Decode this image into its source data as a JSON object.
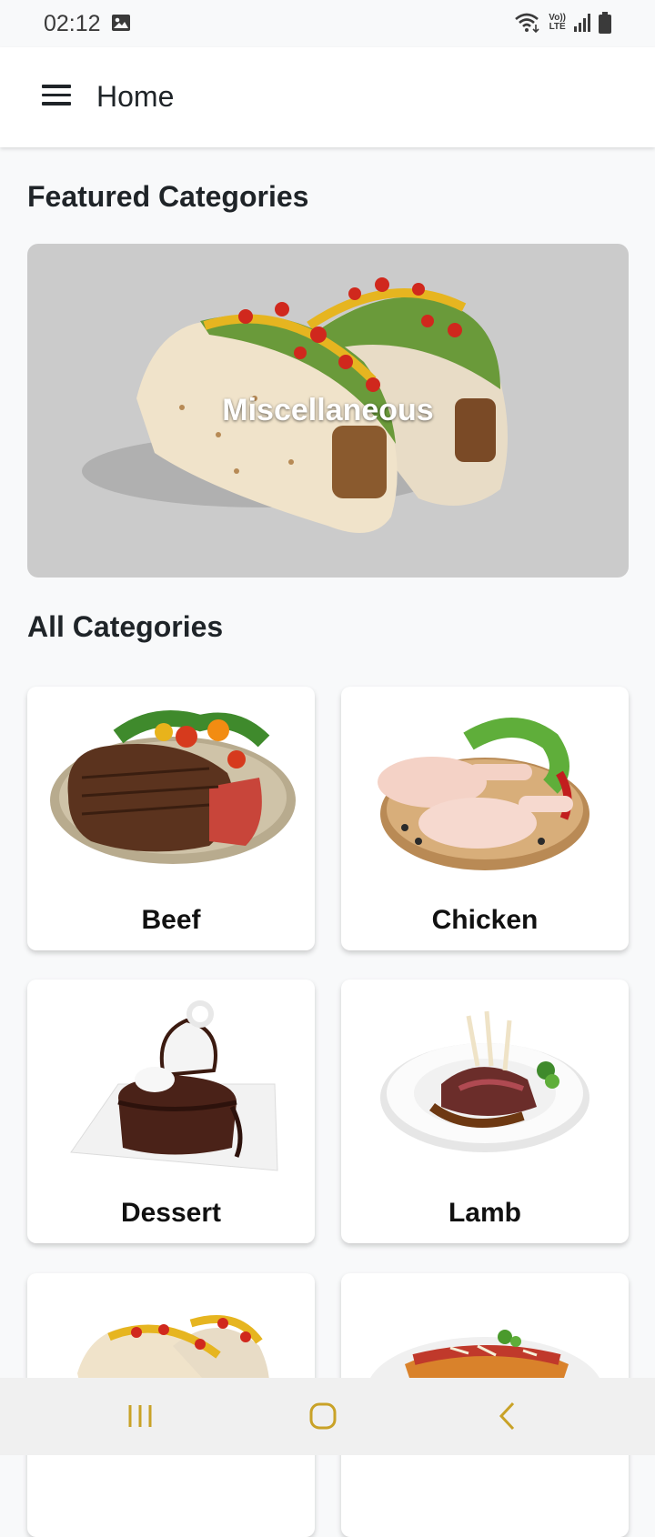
{
  "status_bar": {
    "time": "02:12",
    "icons": [
      "image-icon",
      "wifi-icon",
      "volte-icon",
      "signal-icon",
      "battery-icon"
    ],
    "network_label_top": "Vo))",
    "network_label_bottom": "LTE"
  },
  "app_bar": {
    "title": "Home",
    "menu_icon": "hamburger-menu-icon"
  },
  "featured": {
    "section_title": "Featured Categories",
    "card": {
      "label": "Miscellaneous",
      "image": "tacos-image"
    }
  },
  "all_categories": {
    "section_title": "All Categories",
    "items": [
      {
        "label": "Beef",
        "image": "steak-plate-image"
      },
      {
        "label": "Chicken",
        "image": "raw-chicken-legs-image"
      },
      {
        "label": "Dessert",
        "image": "chocolate-cake-image"
      },
      {
        "label": "Lamb",
        "image": "lamb-rack-image"
      },
      {
        "label": "",
        "image": "tacos-image"
      },
      {
        "label": "",
        "image": "pasta-image"
      }
    ]
  },
  "nav_bar": {
    "buttons": [
      "recent-apps-icon",
      "home-icon",
      "back-icon"
    ]
  },
  "colors": {
    "background": "#f8f9fa",
    "card": "#ffffff",
    "featured_bg": "#cbcbcb",
    "nav_icon": "#c9a227",
    "text": "#1f2428"
  }
}
